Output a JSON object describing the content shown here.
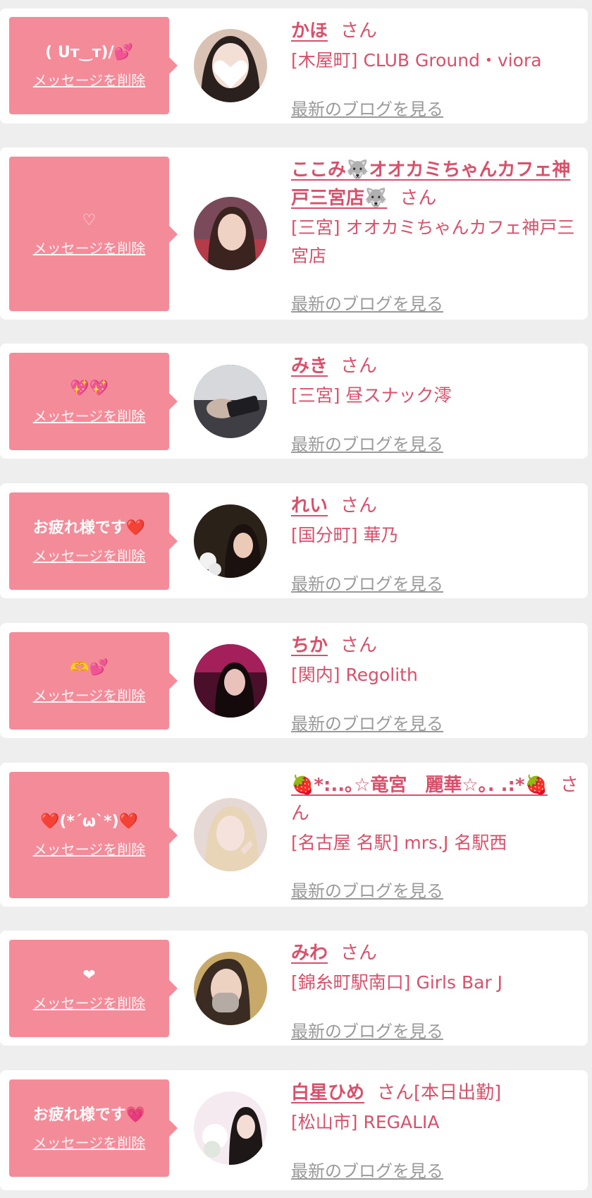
{
  "colors": {
    "accent": "#d9506b",
    "bubble": "#f48b98",
    "background": "#eeeeee",
    "card": "#ffffff",
    "muted_link": "#9a9a9a"
  },
  "labels": {
    "delete": "メッセージを削除",
    "blog": "最新のブログを見る",
    "san": "さん"
  },
  "items": [
    {
      "message": "( Uт‿т)/💕",
      "name": "かほ",
      "suffix": "",
      "shop": "[木屋町] CLUB Ground・viora"
    },
    {
      "message": "♡",
      "name": "ここみ🐺オオカミちゃんカフェ神戸三宮店🐺",
      "suffix": "",
      "shop": "[三宮] オオカミちゃんカフェ神戸三宮店"
    },
    {
      "message": "💖💖",
      "name": "みき",
      "suffix": "",
      "shop": "[三宮] 昼スナック澪"
    },
    {
      "message": "お疲れ様です❤️",
      "name": "れい",
      "suffix": "",
      "shop": "[国分町] 華乃"
    },
    {
      "message": "🫶💕",
      "name": "ちか",
      "suffix": "",
      "shop": "[関内] Regolith"
    },
    {
      "message": "❤️(*´ω`*)❤️",
      "name": "🍓*:..｡☆竜宮　麗華☆｡. .:*🍓",
      "suffix": "",
      "shop": "[名古屋 名駅] mrs.J 名駅西"
    },
    {
      "message": "❤",
      "name": "みわ",
      "suffix": "",
      "shop": "[錦糸町駅南口] Girls Bar J"
    },
    {
      "message": "お疲れ様です💗",
      "name": "白星ひめ",
      "suffix": "[本日出勤]",
      "shop": "[松山市] REGALIA"
    }
  ]
}
